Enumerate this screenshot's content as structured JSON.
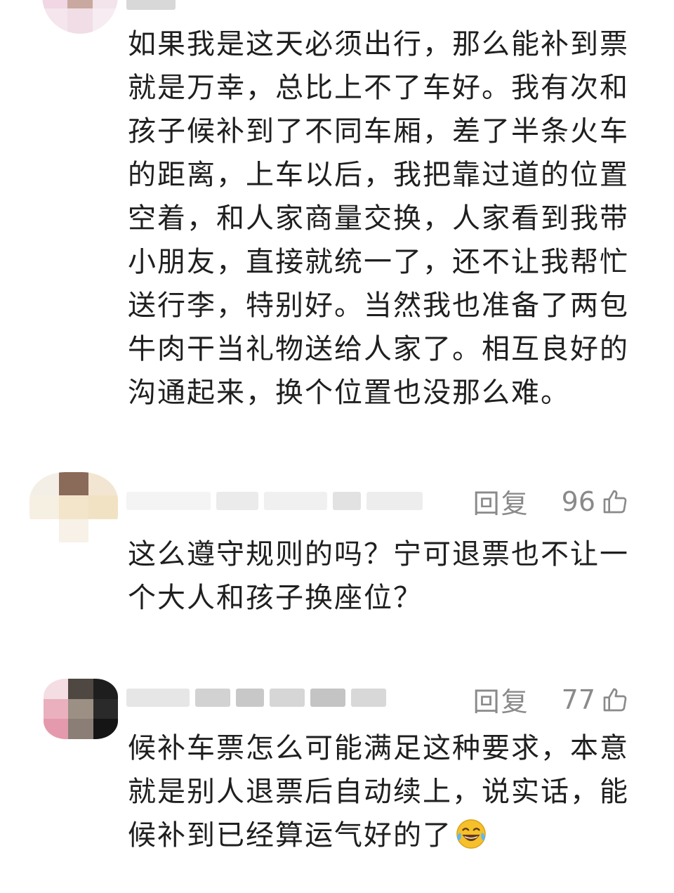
{
  "comments": [
    {
      "text_lines": [
        "如果我是这天必须出行，那么能补到票",
        "就是万幸，总比上不了车好。我有次和",
        "孩子候补到了不同车厢，差了半条火车",
        "的距离，上车以后，我把靠过道的位置",
        "空着，和人家商量交换，人家看到我带",
        "小朋友，直接就统一了，还不让我帮忙",
        "送行李，特别好。当然我也准备了两包",
        "牛肉干当礼物送给人家了。相互良好的",
        "沟通起来，换个位置也没那么难。"
      ]
    },
    {
      "reply_label": "回复",
      "likes": "96",
      "text_lines": [
        "这么遵守规则的吗？宁可退票也不让一",
        "个大人和孩子换座位？"
      ]
    },
    {
      "reply_label": "回复",
      "likes": "77",
      "text_lines": [
        "候补车票怎么可能满足这种要求，本意",
        "就是别人退票后自动续上，说实话，能",
        "候补到已经算运气好的了"
      ],
      "trailing_emoji": "laughing-tears-emoji"
    }
  ],
  "colors": {
    "text": "#1f1f1f",
    "meta": "#8a8a8a",
    "emoji": "#f5c02a"
  }
}
